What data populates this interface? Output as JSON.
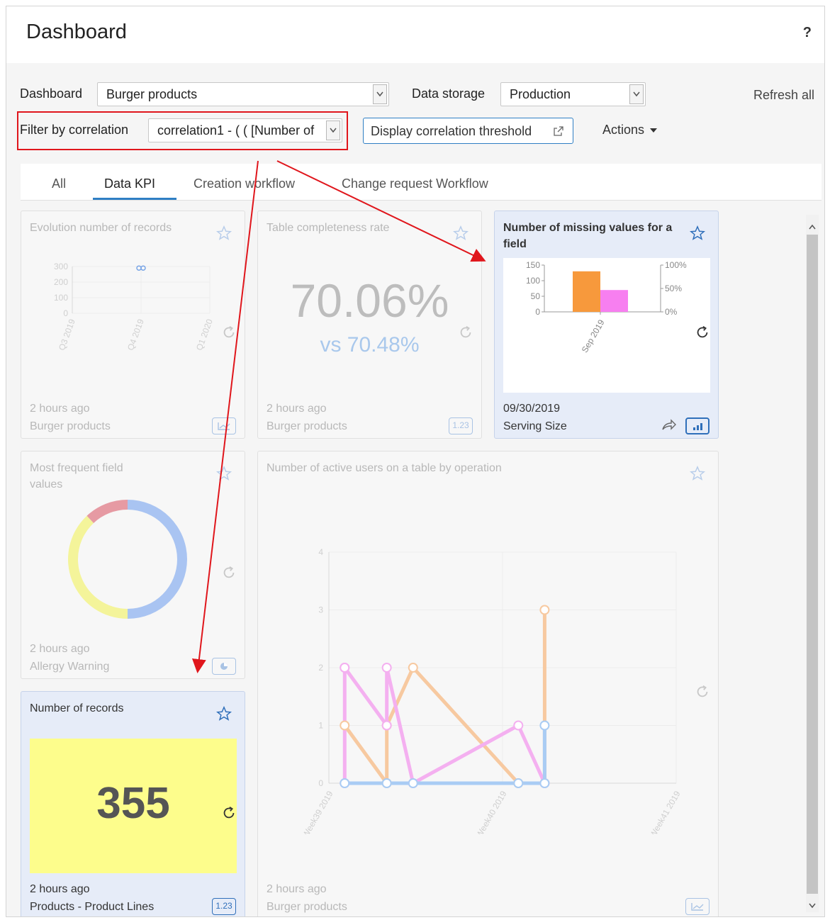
{
  "header": {
    "title": "Dashboard",
    "help": "?"
  },
  "toolbar": {
    "dashboard_label": "Dashboard",
    "dashboard_value": "Burger products",
    "storage_label": "Data storage",
    "storage_value": "Production",
    "refresh_all": "Refresh all",
    "filter_label": "Filter by correlation",
    "filter_value": "correlation1 - ( ( [Number of",
    "threshold_button": "Display correlation threshold",
    "actions": "Actions"
  },
  "tabs": [
    "All",
    "Data KPI",
    "Creation workflow",
    "Change request Workflow"
  ],
  "cards": {
    "evolution": {
      "title": "Evolution number of records",
      "time": "2 hours ago",
      "source": "Burger products"
    },
    "completeness": {
      "title": "Table completeness rate",
      "value": "70.06%",
      "compare": "vs 70.48%",
      "time": "2 hours ago",
      "source": "Burger products",
      "badge": "1.23"
    },
    "missing": {
      "title": "Number of missing values for a field",
      "date": "09/30/2019",
      "field": "Serving Size"
    },
    "frequent": {
      "title": "Most frequent field values",
      "time": "2 hours ago",
      "source": "Allergy Warning"
    },
    "active_users": {
      "title": "Number of active users on a table by operation",
      "time": "2 hours ago",
      "source": "Burger products"
    },
    "records": {
      "title": "Number of records",
      "value": "355",
      "time": "2 hours ago",
      "source": "Products - Product Lines",
      "badge": "1.23"
    }
  },
  "chart_data": [
    {
      "type": "scatter",
      "categories": [
        "Q3 2019",
        "Q4 2019",
        "Q1 2020"
      ],
      "y_ticks": [
        "0",
        "100",
        "200",
        "300"
      ],
      "ylim": [
        0,
        300
      ],
      "points": [
        {
          "x": "Q4 2019",
          "y": 290
        },
        {
          "x": "Q4 2019",
          "y": 290
        }
      ]
    },
    {
      "type": "bar",
      "categories": [
        "Sep 2019"
      ],
      "y_ticks": [
        "0",
        "50",
        "100",
        "150"
      ],
      "y2_ticks": [
        "0%",
        "50%",
        "100%"
      ],
      "ylim": [
        0,
        150
      ],
      "series": [
        {
          "values": [
            130
          ],
          "color": "#f7993c"
        },
        {
          "values": [
            70
          ],
          "color": "#f77ff0"
        }
      ]
    },
    {
      "type": "pie",
      "donut": true,
      "slices": [
        {
          "value": 50,
          "color": "#a9c4f2"
        },
        {
          "value": 38,
          "color": "#f4f49a"
        },
        {
          "value": 12,
          "color": "#e69aa3"
        }
      ]
    },
    {
      "type": "line",
      "x_ticks": [
        "Week 39 2019",
        "Week 40 2019",
        "Week 41 2019"
      ],
      "y_ticks": [
        "0",
        "1",
        "2",
        "3",
        "4"
      ],
      "ylim": [
        0,
        4
      ],
      "series": [
        {
          "color": "#f7c9a0",
          "points": [
            [
              0.3,
              1
            ],
            [
              1.1,
              0
            ],
            [
              1.1,
              1
            ],
            [
              1.6,
              2
            ],
            [
              3.6,
              0
            ],
            [
              4.1,
              0
            ],
            [
              4.1,
              3
            ]
          ]
        },
        {
          "color": "#f4b0f0",
          "points": [
            [
              0.3,
              2
            ],
            [
              0.3,
              0
            ],
            [
              0.3,
              2
            ],
            [
              1.1,
              1
            ],
            [
              1.1,
              2
            ],
            [
              1.6,
              0
            ],
            [
              3.6,
              1
            ],
            [
              4.1,
              0
            ]
          ]
        },
        {
          "color": "#a9ccf4",
          "points": [
            [
              0.3,
              0
            ],
            [
              1.1,
              0
            ],
            [
              1.6,
              0
            ],
            [
              3.6,
              0
            ],
            [
              4.1,
              0
            ],
            [
              4.1,
              1
            ]
          ]
        }
      ],
      "x_range": [
        0,
        6.6
      ]
    }
  ]
}
